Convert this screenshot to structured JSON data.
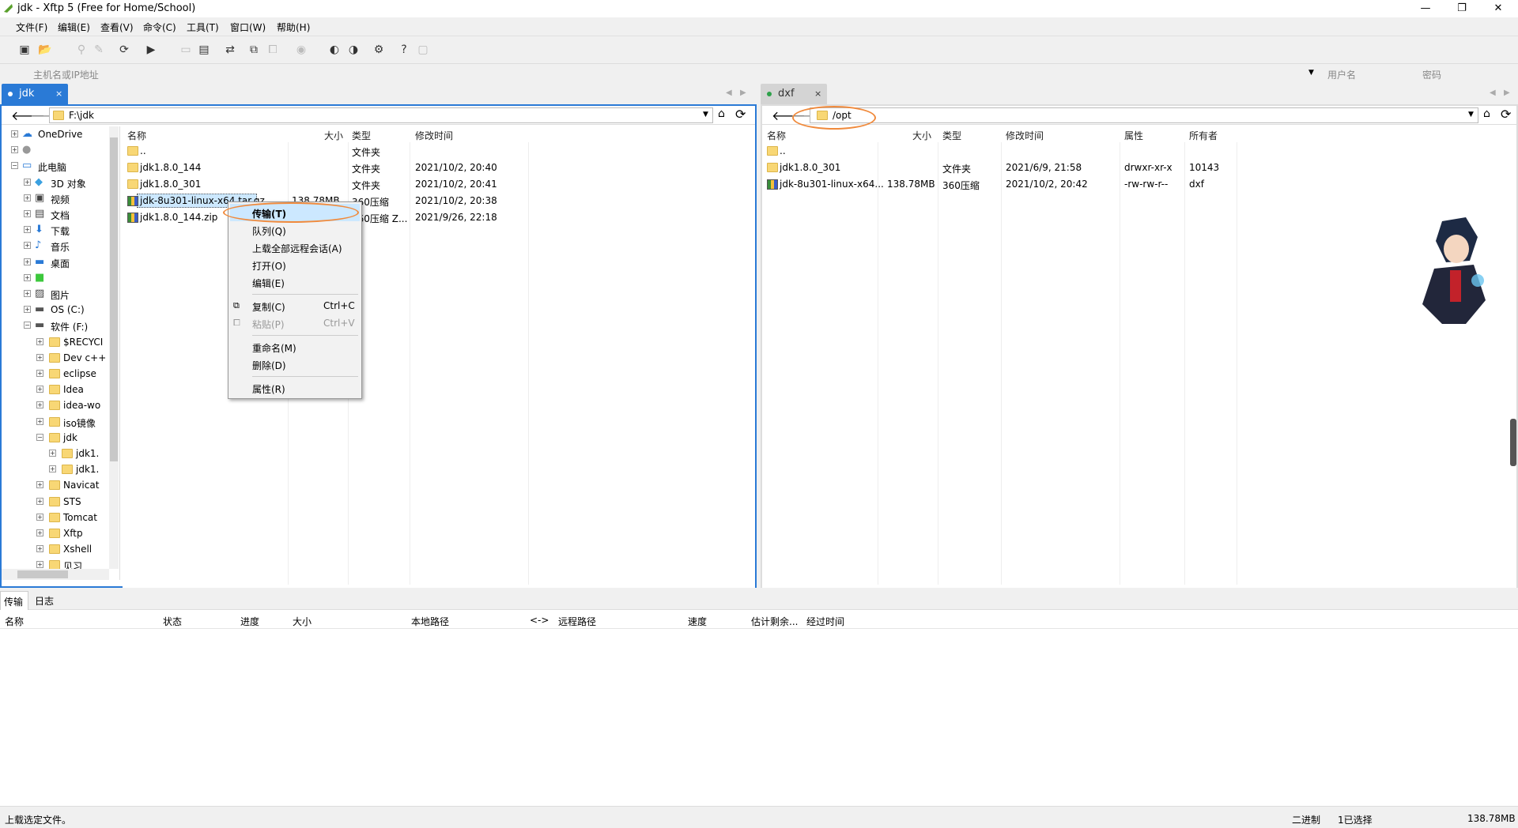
{
  "window": {
    "title": "jdk - Xftp 5 (Free for Home/School)",
    "minimize": "—",
    "maximize": "❐",
    "close": "✕"
  },
  "menu": [
    "文件(F)",
    "编辑(E)",
    "查看(V)",
    "命令(C)",
    "工具(T)",
    "窗口(W)",
    "帮助(H)"
  ],
  "address": {
    "host_placeholder": "主机名或IP地址",
    "user_placeholder": "用户名",
    "password_placeholder": "密码"
  },
  "left_tab": {
    "label": "jdk",
    "close": "×"
  },
  "right_tab": {
    "label": "dxf",
    "close": "×"
  },
  "left_path": "F:\\jdk",
  "right_path": "/opt",
  "left_columns": {
    "name": "名称",
    "size": "大小",
    "type": "类型",
    "modified": "修改时间"
  },
  "right_columns": {
    "name": "名称",
    "size": "大小",
    "type": "类型",
    "modified": "修改时间",
    "attr": "属性",
    "owner": "所有者"
  },
  "left_files": [
    {
      "name": "..",
      "size": "",
      "type": "文件夹",
      "modified": "",
      "icon": "folder"
    },
    {
      "name": "jdk1.8.0_144",
      "size": "",
      "type": "文件夹",
      "modified": "2021/10/2, 20:40",
      "icon": "folder"
    },
    {
      "name": "jdk1.8.0_301",
      "size": "",
      "type": "文件夹",
      "modified": "2021/10/2, 20:41",
      "icon": "folder"
    },
    {
      "name": "jdk-8u301-linux-x64.tar.gz",
      "size": "138.78MB",
      "type": "360压缩",
      "modified": "2021/10/2, 20:38",
      "icon": "zip"
    },
    {
      "name": "jdk1.8.0_144.zip",
      "size": "",
      "type": "360压缩 Z...",
      "modified": "2021/9/26, 22:18",
      "icon": "zip"
    }
  ],
  "right_files": [
    {
      "name": "..",
      "size": "",
      "type": "",
      "modified": "",
      "attr": "",
      "owner": "",
      "icon": "folder"
    },
    {
      "name": "jdk1.8.0_301",
      "size": "",
      "type": "文件夹",
      "modified": "2021/6/9, 21:58",
      "attr": "drwxr-xr-x",
      "owner": "10143",
      "icon": "folder"
    },
    {
      "name": "jdk-8u301-linux-x64...",
      "size": "138.78MB",
      "type": "360压缩",
      "modified": "2021/10/2, 20:42",
      "attr": "-rw-rw-r--",
      "owner": "dxf",
      "icon": "zip"
    }
  ],
  "tree": [
    {
      "label": "OneDrive",
      "level": 0,
      "icon": "cloud-icon"
    },
    {
      "label": "",
      "level": 0,
      "icon": "user-icon"
    },
    {
      "label": "此电脑",
      "level": 0,
      "icon": "computer-icon"
    },
    {
      "label": "3D 对象",
      "level": 1,
      "icon": "cube-icon"
    },
    {
      "label": "视频",
      "level": 1,
      "icon": "video-icon"
    },
    {
      "label": "文档",
      "level": 1,
      "icon": "document-icon"
    },
    {
      "label": "下载",
      "level": 1,
      "icon": "download-icon"
    },
    {
      "label": "音乐",
      "level": 1,
      "icon": "music-icon"
    },
    {
      "label": "桌面",
      "level": 1,
      "icon": "desktop-icon"
    },
    {
      "label": "",
      "level": 1,
      "icon": "app-icon"
    },
    {
      "label": "图片",
      "level": 1,
      "icon": "picture-icon"
    },
    {
      "label": "OS (C:)",
      "level": 1,
      "icon": "drive-icon"
    },
    {
      "label": "软件 (F:)",
      "level": 1,
      "icon": "drive-icon"
    },
    {
      "label": "$RECYCI",
      "level": 2,
      "icon": "folder-icon"
    },
    {
      "label": "Dev c++",
      "level": 2,
      "icon": "folder-icon"
    },
    {
      "label": "eclipse",
      "level": 2,
      "icon": "folder-icon"
    },
    {
      "label": "Idea",
      "level": 2,
      "icon": "folder-icon"
    },
    {
      "label": "idea-wo",
      "level": 2,
      "icon": "folder-icon"
    },
    {
      "label": "iso镜像",
      "level": 2,
      "icon": "folder-icon"
    },
    {
      "label": "jdk",
      "level": 2,
      "icon": "folder-icon"
    },
    {
      "label": "jdk1.",
      "level": 3,
      "icon": "folder-icon"
    },
    {
      "label": "jdk1.",
      "level": 3,
      "icon": "folder-icon"
    },
    {
      "label": "Navicat",
      "level": 2,
      "icon": "folder-icon"
    },
    {
      "label": "STS",
      "level": 2,
      "icon": "folder-icon"
    },
    {
      "label": "Tomcat",
      "level": 2,
      "icon": "folder-icon"
    },
    {
      "label": "Xftp",
      "level": 2,
      "icon": "folder-icon"
    },
    {
      "label": "Xshell",
      "level": 2,
      "icon": "folder-icon"
    },
    {
      "label": "见习",
      "level": 2,
      "icon": "folder-icon"
    }
  ],
  "context_menu": {
    "transfer": "传输(T)",
    "queue": "队列(Q)",
    "upload_all": "上载全部远程会话(A)",
    "open": "打开(O)",
    "edit": "编辑(E)",
    "copy": "复制(C)",
    "copy_shortcut": "Ctrl+C",
    "paste": "粘贴(P)",
    "paste_shortcut": "Ctrl+V",
    "rename": "重命名(M)",
    "delete": "删除(D)",
    "properties": "属性(R)"
  },
  "lower_tabs": [
    "传输",
    "日志"
  ],
  "transfer_columns": [
    "名称",
    "状态",
    "进度",
    "大小",
    "本地路径",
    "<->",
    "远程路径",
    "速度",
    "估计剩余...",
    "经过时间"
  ],
  "status": {
    "message": "上载选定文件。",
    "mode": "二进制",
    "selected": "1已选择",
    "size": "138.78MB"
  },
  "colors": {
    "accent": "#2a7ad6",
    "highlight": "#cce8ff",
    "annotation": "#f08a3c"
  }
}
